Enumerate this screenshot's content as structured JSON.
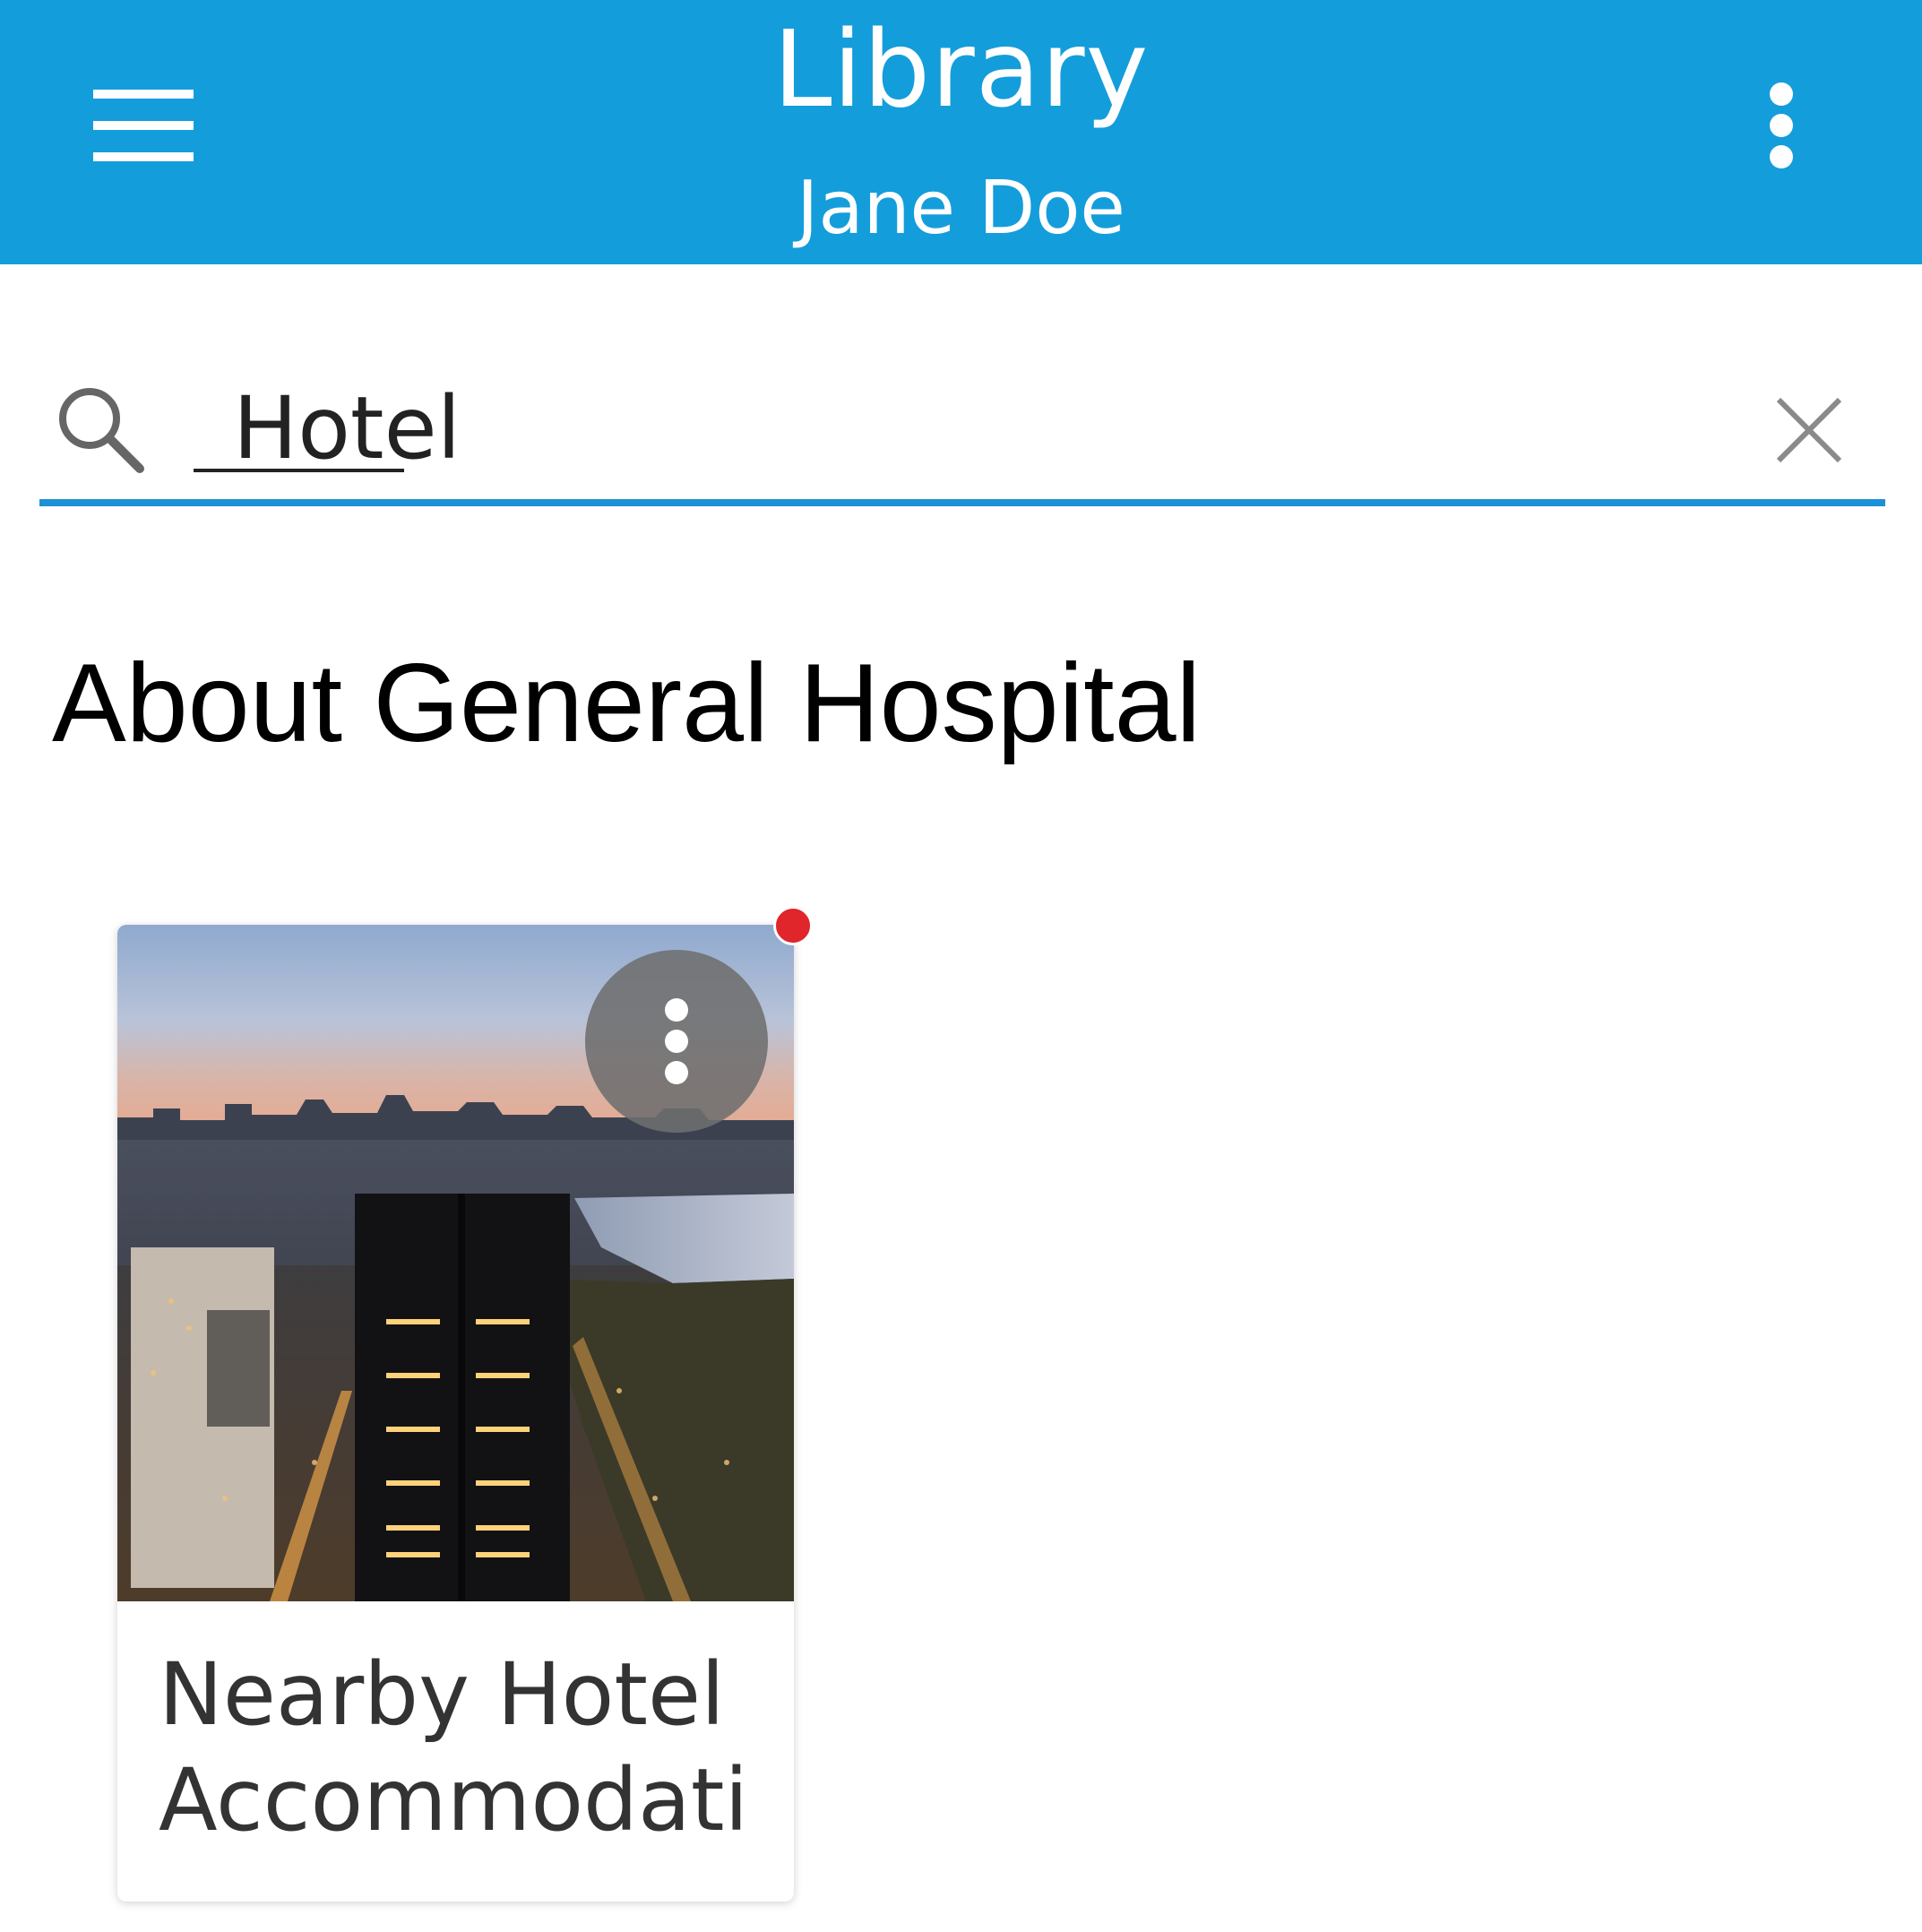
{
  "header": {
    "title": "Library",
    "subtitle": "Jane Doe",
    "background_color": "#149ddb",
    "menu_icon": "hamburger-menu-icon",
    "overflow_icon": "more-vertical-icon"
  },
  "search": {
    "value": "Hotel",
    "placeholder": "",
    "search_icon": "search-icon",
    "clear_icon": "close-icon",
    "underline_color": "#1a91d6"
  },
  "section": {
    "title": "About General Hospital"
  },
  "cards": [
    {
      "title": "Nearby Hotel Accommodatic",
      "image": "city-skyline-at-dusk",
      "more_icon": "more-vertical-icon",
      "badge_color": "#e0252b"
    }
  ]
}
